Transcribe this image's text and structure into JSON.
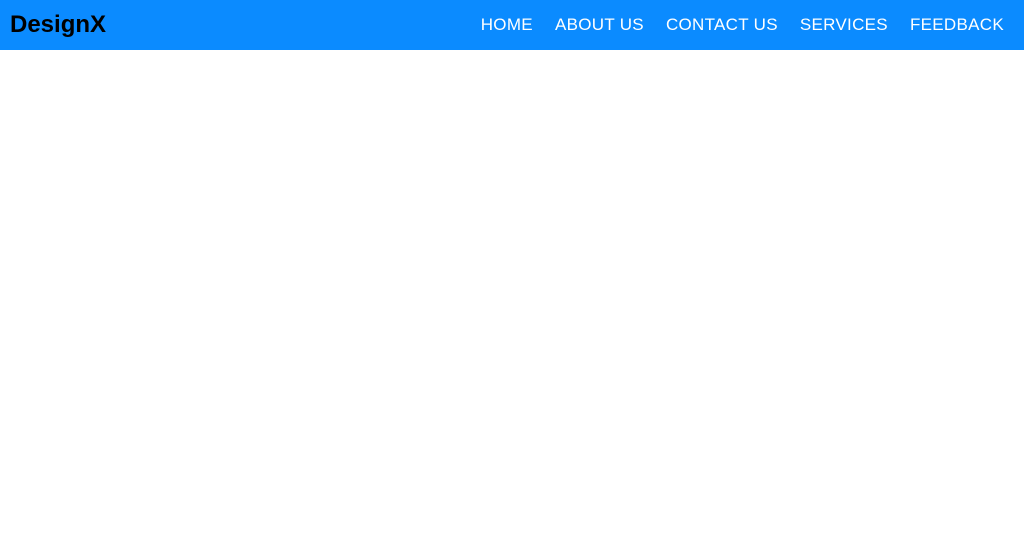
{
  "header": {
    "logo": "DesignX",
    "nav": [
      "HOME",
      "ABOUT US",
      "CONTACT US",
      "SERVICES",
      "FEEDBACK"
    ]
  }
}
